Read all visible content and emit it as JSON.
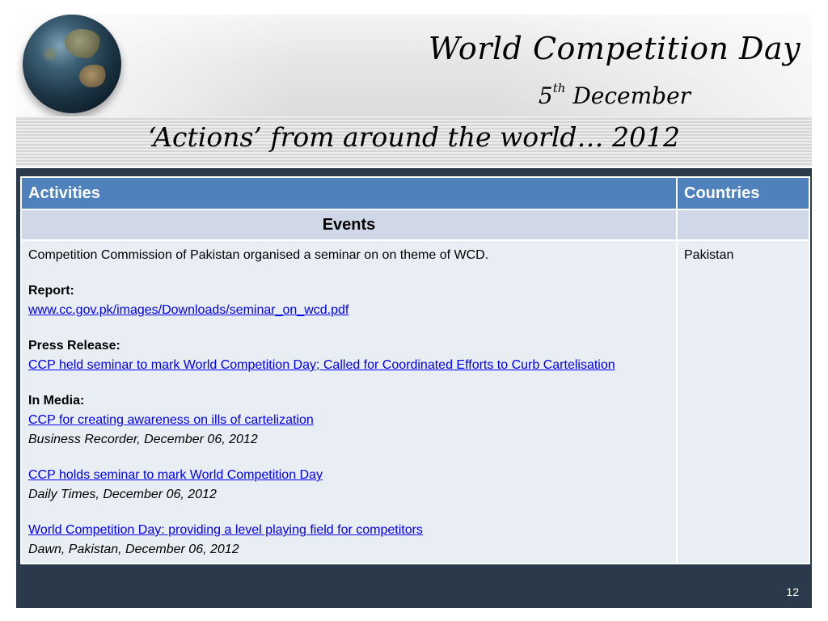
{
  "header": {
    "title": "World Competition Day",
    "date_day": "5",
    "date_suffix": "th",
    "date_month": "December",
    "subtitle": "‘Actions’ from around the world… 2012"
  },
  "table": {
    "col_activities": "Activities",
    "col_countries": "Countries",
    "section_label": "Events",
    "row": {
      "intro": "Competition Commission of Pakistan organised a seminar on on theme of WCD.",
      "report_label": "Report:",
      "report_link": "www.cc.gov.pk/images/Downloads/seminar_on_wcd.pdf",
      "press_label": "Press Release:",
      "press_link": "CCP held seminar to mark World Competition Day; Called for Coordinated Efforts to Curb Cartelisation",
      "media_label": "In Media:",
      "media": [
        {
          "link": "CCP for creating awareness on ills of cartelization",
          "source": "Business Recorder, December 06, 2012"
        },
        {
          "link": "CCP holds seminar to mark World Competition Day",
          "source": "Daily Times, December 06, 2012"
        },
        {
          "link": "World Competition Day: providing a level playing field for competitors",
          "source": "Dawn, Pakistan, December 06, 2012"
        }
      ],
      "country": "Pakistan"
    }
  },
  "page_number": "12",
  "colors": {
    "header_blue": "#4f81bd",
    "panel_dark": "#2a3a4a",
    "events_bg": "#d0d8e8",
    "body_bg": "#e9edf4",
    "link": "#0000ee"
  }
}
